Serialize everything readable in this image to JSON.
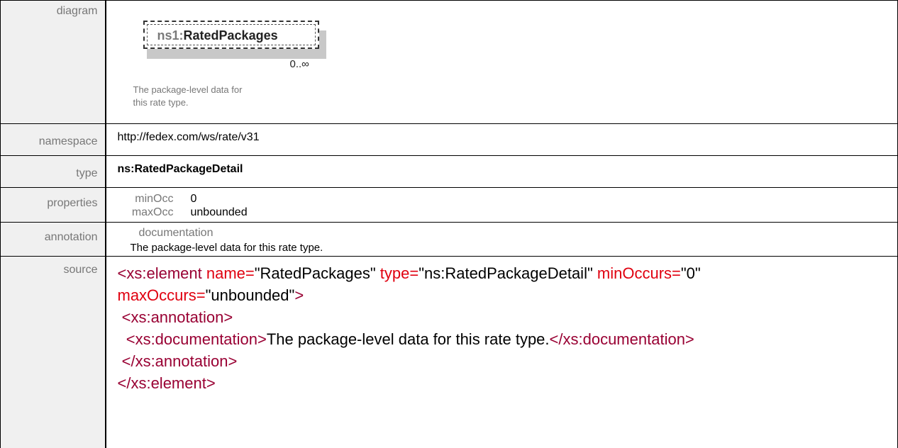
{
  "rows": {
    "diagram": {
      "label": "diagram",
      "prefix": "ns1:",
      "name": "RatedPackages",
      "occurs": "0..∞",
      "doc_line1": "The package-level data for",
      "doc_line2": "this rate type."
    },
    "namespace": {
      "label": "namespace",
      "value": "http://fedex.com/ws/rate/v31"
    },
    "type": {
      "label": "type",
      "value": "ns:RatedPackageDetail"
    },
    "properties": {
      "label": "properties",
      "items": [
        {
          "key": "minOcc",
          "value": "0"
        },
        {
          "key": "maxOcc",
          "value": "unbounded"
        }
      ]
    },
    "annotation": {
      "label": "annotation",
      "heading": "documentation",
      "text": "The package-level data for this rate type."
    },
    "source": {
      "label": "source",
      "l1_tag": "<xs:element",
      "l1_attr1": " name=",
      "l1_val1": "\"RatedPackages\"",
      "l1_attr2": " type=",
      "l1_val2": "\"ns:RatedPackageDetail\"",
      "l1_attr3": " minOccurs=",
      "l1_val3": "\"0\"",
      "l2_attr": "maxOccurs=",
      "l2_val": "\"unbounded\"",
      "l2_end": ">",
      "l3_tag": " <xs:annotation>",
      "l4_open": "  <xs:documentation>",
      "l4_text": "The package-level data for this rate type.",
      "l4_close": "</xs:documentation>",
      "l5_tag": " </xs:annotation>",
      "l6_tag": "</xs:element>"
    }
  }
}
